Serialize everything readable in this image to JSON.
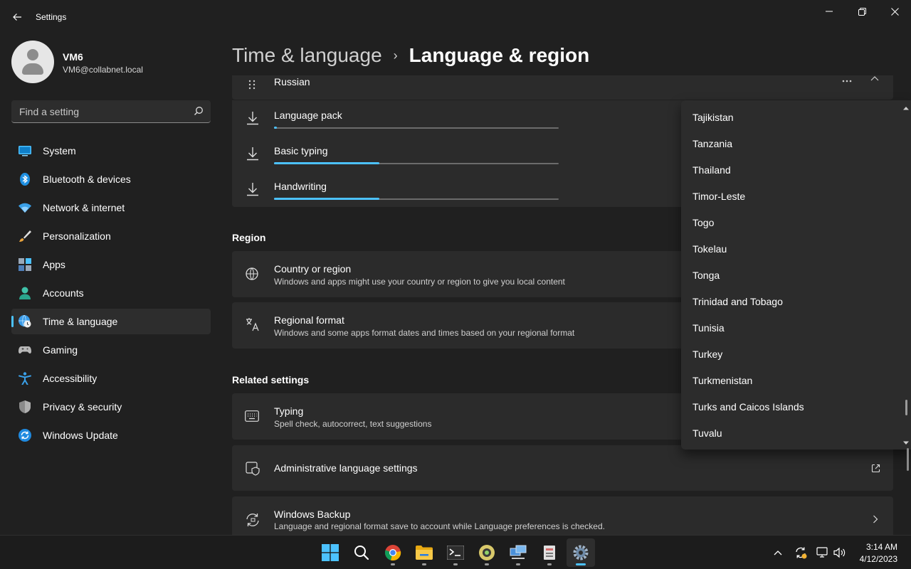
{
  "window": {
    "title": "Settings"
  },
  "profile": {
    "name": "VM6",
    "email": "VM6@collabnet.local"
  },
  "search": {
    "placeholder": "Find a setting"
  },
  "sidebar": {
    "items": [
      {
        "label": "System",
        "icon": "monitor-icon",
        "active": false
      },
      {
        "label": "Bluetooth & devices",
        "icon": "bluetooth-icon",
        "active": false
      },
      {
        "label": "Network & internet",
        "icon": "wifi-icon",
        "active": false
      },
      {
        "label": "Personalization",
        "icon": "paintbrush-icon",
        "active": false
      },
      {
        "label": "Apps",
        "icon": "apps-icon",
        "active": false
      },
      {
        "label": "Accounts",
        "icon": "person-icon",
        "active": false
      },
      {
        "label": "Time & language",
        "icon": "globe-clock-icon",
        "active": true
      },
      {
        "label": "Gaming",
        "icon": "gamepad-icon",
        "active": false
      },
      {
        "label": "Accessibility",
        "icon": "accessibility-icon",
        "active": false
      },
      {
        "label": "Privacy & security",
        "icon": "shield-icon",
        "active": false
      },
      {
        "label": "Windows Update",
        "icon": "update-icon",
        "active": false
      }
    ]
  },
  "header": {
    "parent": "Time & language",
    "separator": "›",
    "current": "Language & region"
  },
  "language": {
    "name": "Russian",
    "downloads": [
      {
        "label": "Language pack",
        "progress": 0.01
      },
      {
        "label": "Basic typing",
        "progress": 0.37
      },
      {
        "label": "Handwriting",
        "progress": 0.37
      }
    ]
  },
  "region": {
    "section_title": "Region",
    "country": {
      "title": "Country or region",
      "desc": "Windows and apps might use your country or region to give you local content"
    },
    "format": {
      "title": "Regional format",
      "desc": "Windows and some apps format dates and times based on your regional format"
    }
  },
  "related": {
    "section_title": "Related settings",
    "typing": {
      "title": "Typing",
      "desc": "Spell check, autocorrect, text suggestions"
    },
    "admin": {
      "title": "Administrative language settings"
    },
    "backup": {
      "title": "Windows Backup",
      "desc": "Language and regional format save to account while Language preferences is checked."
    }
  },
  "dropdown": {
    "items": [
      "Tajikistan",
      "Tanzania",
      "Thailand",
      "Timor-Leste",
      "Togo",
      "Tokelau",
      "Tonga",
      "Trinidad and Tobago",
      "Tunisia",
      "Turkey",
      "Turkmenistan",
      "Turks and Caicos Islands",
      "Tuvalu"
    ]
  },
  "taskbar": {
    "time": "3:14 AM",
    "date": "4/12/2023"
  },
  "colors": {
    "accent": "#4cc2ff",
    "background": "#202020",
    "card": "#2b2b2b"
  }
}
